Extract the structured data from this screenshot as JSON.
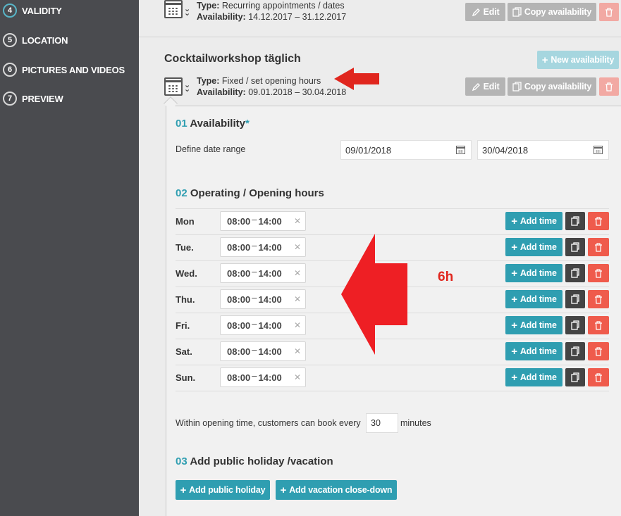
{
  "sidebar": {
    "steps": [
      {
        "num": "4",
        "label": "VALIDITY"
      },
      {
        "num": "5",
        "label": "LOCATION"
      },
      {
        "num": "6",
        "label": "PICTURES AND VIDEOS"
      },
      {
        "num": "7",
        "label": "PREVIEW"
      }
    ]
  },
  "top_entry": {
    "type_label": "Type:",
    "type_value": "Recurring appointments / dates",
    "availability_label": "Availability:",
    "availability_value": "14.12.2017 – 31.12.2017",
    "edit_label": "Edit",
    "copy_label": "Copy availability"
  },
  "product": {
    "title": "Cocktailworkshop täglich",
    "new_availability_label": "New availability",
    "type_label": "Type:",
    "type_value": "Fixed / set opening hours",
    "availability_label": "Availability:",
    "availability_value": "09.01.2018 – 30.04.2018",
    "edit_label": "Edit",
    "copy_label": "Copy availability"
  },
  "section1": {
    "num": "01",
    "title": "Availability",
    "required_mark": "*",
    "date_range_label": "Define date range",
    "start_date": "09/01/2018",
    "end_date": "30/04/2018"
  },
  "section2": {
    "num": "02",
    "title": "Operating / Opening hours",
    "add_time_label": "Add time",
    "days": [
      {
        "day": "Mon",
        "from": "08:00",
        "to": "14:00"
      },
      {
        "day": "Tue.",
        "from": "08:00",
        "to": "14:00"
      },
      {
        "day": "Wed.",
        "from": "08:00",
        "to": "14:00"
      },
      {
        "day": "Thu.",
        "from": "08:00",
        "to": "14:00"
      },
      {
        "day": "Fri.",
        "from": "08:00",
        "to": "14:00"
      },
      {
        "day": "Sat.",
        "from": "08:00",
        "to": "14:00"
      },
      {
        "day": "Sun.",
        "from": "08:00",
        "to": "14:00"
      }
    ],
    "booking_text_before": "Within opening time, customers can book every",
    "booking_interval": "30",
    "booking_text_after": "minutes"
  },
  "section3": {
    "num": "03",
    "title": "Add public holiday /vacation",
    "add_holiday_label": "Add public holiday",
    "add_vacation_label": "Add vacation close-down"
  },
  "annotation": {
    "text": "6h",
    "color": "#e0261e"
  },
  "colors": {
    "accent": "#2f9eb1",
    "danger": "#ef5b4c",
    "sidebar_bg": "#4a4b4f"
  }
}
